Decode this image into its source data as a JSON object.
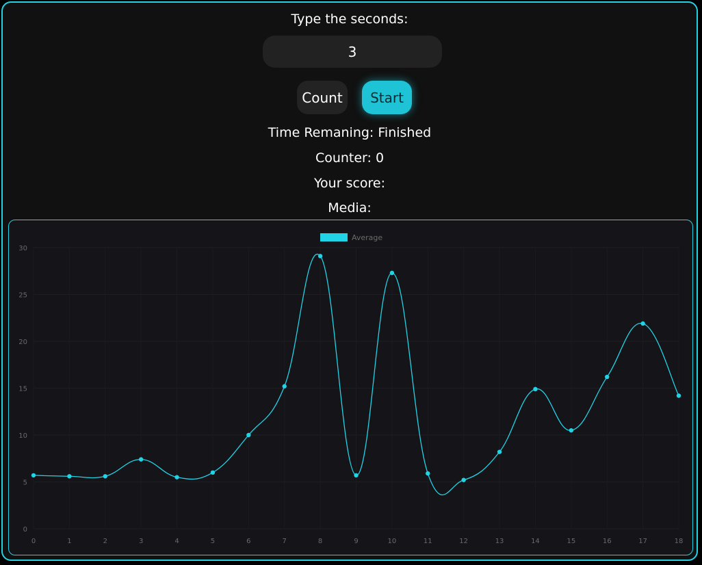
{
  "form": {
    "prompt": "Type the seconds:",
    "seconds_value": "3",
    "count_label": "Count",
    "start_label": "Start"
  },
  "status": {
    "time_remaining": "Time Remaning: Finished",
    "counter": "Counter: 0",
    "score": "Your score:",
    "media": "Media:"
  },
  "colors": {
    "accent": "#22d3e6",
    "background": "#111111",
    "chart_background": "#151519"
  },
  "chart_data": {
    "type": "line",
    "x": [
      0,
      1,
      2,
      3,
      4,
      5,
      6,
      7,
      8,
      9,
      10,
      11,
      12,
      13,
      14,
      15,
      16,
      17,
      18
    ],
    "series": [
      {
        "name": "Average",
        "color": "#22d3e6",
        "values": [
          5.7,
          5.6,
          5.6,
          7.4,
          5.5,
          6.0,
          10.0,
          15.2,
          29.1,
          5.7,
          27.3,
          5.9,
          5.2,
          8.2,
          14.9,
          10.5,
          16.2,
          21.9,
          14.2
        ]
      }
    ],
    "y_ticks": [
      0,
      5,
      10,
      15,
      20,
      25,
      30
    ],
    "ylim": [
      0,
      30
    ],
    "legend": "top-center",
    "grid": true
  }
}
